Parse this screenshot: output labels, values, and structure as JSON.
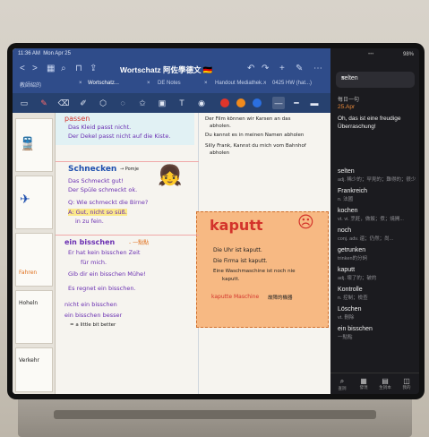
{
  "status": {
    "time": "11:36 AM",
    "date": "Mon Apr 25",
    "battery": "98%",
    "dots": "•••"
  },
  "notes": {
    "title": "Wortschatz 阿佐學德文 🇩🇪",
    "tabs": [
      "教師紹的",
      "Wortschatz...",
      "DE Notes",
      "Handout Mediathek...",
      "0425 HW (hat...)"
    ],
    "tab_close": "×",
    "nav_icons": {
      "back": "<",
      "forward": ">",
      "grid": "▦",
      "search": "⌕",
      "bookmark": "⊓",
      "share": "⇪",
      "undo": "↶",
      "redo": "↷",
      "more": "⋯",
      "add_page": "+",
      "pen_toggle": "✎"
    },
    "tools": [
      "pages-icon",
      "pen-icon",
      "eraser-icon",
      "highlighter-icon",
      "shapes-icon",
      "lasso-icon",
      "star-icon",
      "image-icon",
      "text-icon",
      "mic-icon"
    ],
    "tool_glyphs": [
      "▭",
      "✎",
      "⌫",
      "✐",
      "⬡",
      "◌",
      "✩",
      "▣",
      "T",
      "◉"
    ],
    "colors": {
      "red": "#e0352b",
      "orange": "#f08a1c",
      "blue": "#2b6fe0",
      "highlight": "#f6d75e",
      "kaputt_bg": "#f7b983"
    },
    "content": {
      "passen_word": "passen",
      "passen_l1": "Das Kleid passt nicht.",
      "passen_l2": "Der Dekel passt nicht auf die Kiste.",
      "film_l1": "Der Film können wir Karsen an das",
      "film_l1b": "abholen.",
      "film_l2": "Du kannst es in meinen Namen abholen",
      "film_l3": "Silly Frank, Kannst du mich vom Bahnhof",
      "film_l3b": "abholen",
      "schnecken_word": "Schnecken",
      "schnecken_note": "→ Pomje",
      "schnecken_l1": "Das Schmeckt gut!",
      "schnecken_l2": "Der Spüle schmeckt ok.",
      "schnecken_q": "Q: Wie schmeckt die Birne?",
      "schnecken_a1": "A: Gut, nicht so süß.",
      "schnecken_a2": "in zu fein.",
      "kaputt_word": "kaputt",
      "kaputt_l1": "Die Uhr ist kaputt.",
      "kaputt_l2": "Die Firma ist kaputt.",
      "kaputt_l3": "Eine Waschmaschine ist noch nie",
      "kaputt_l3b": "kaputt.",
      "kaputt_l4": "kaputte Maschine",
      "kaputt_l4b": "故障的機器",
      "bisschen_word": "ein bisschen",
      "bisschen_note": "- 一點點",
      "bisschen_l1": "Er hat kein bisschen Zeit",
      "bisschen_l1b": "für mich.",
      "bisschen_l2": "Gib dir ein bisschen Mühe!",
      "bisschen_l3": "Es regnet ein bisschen.",
      "nicht_l": "nicht ein bisschen",
      "besser_l": "ein bisschen besser",
      "besser_tr": "= a little bit better",
      "side_lbl1": "Fahren",
      "side_lbl2": "Hoheln",
      "side_lbl3": "Verkehr"
    }
  },
  "dict": {
    "search_value": "selten",
    "clear": "×",
    "section": "每日一句",
    "date": "25.Apr",
    "quote": "Oh, das ist eine freudige Überraschung!",
    "entries": [
      {
        "word": "selten",
        "gloss": "adj. 稀少的；罕見的；難得的；很少..."
      },
      {
        "word": "Frankreich",
        "gloss": "n. 法國"
      },
      {
        "word": "kochen",
        "gloss": "vt. vi. 烹飪，做飯；煮；燒開..."
      },
      {
        "word": "noch",
        "gloss": "conj. adv. 還；仍然；尚..."
      },
      {
        "word": "getrunken",
        "gloss": "trinken的分詞"
      },
      {
        "word": "kaputt",
        "gloss": "adj. 壞了的；破的"
      },
      {
        "word": "Kontrolle",
        "gloss": "n. 控制；檢查"
      },
      {
        "word": "Löschen",
        "gloss": "vt. 刪除"
      }
    ],
    "bisschen_entry": {
      "word": "ein bisschen",
      "gloss": "一點點"
    },
    "bottom_nav": [
      {
        "icon": "search-icon",
        "glyph": "⌕",
        "label": "查詞"
      },
      {
        "icon": "grid-icon",
        "glyph": "▦",
        "label": "發現"
      },
      {
        "icon": "book-icon",
        "glyph": "▤",
        "label": "生詞本"
      },
      {
        "icon": "profile-icon",
        "glyph": "◫",
        "label": "我的"
      }
    ]
  }
}
